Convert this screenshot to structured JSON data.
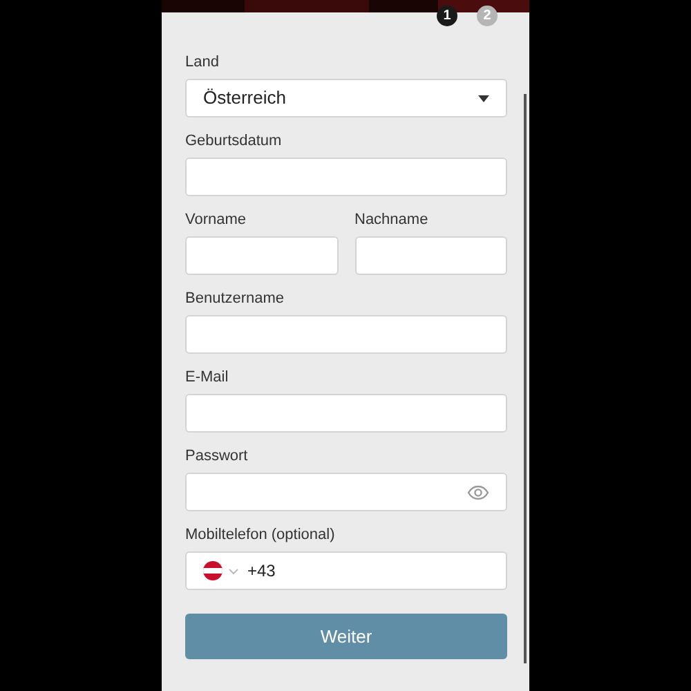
{
  "steps": [
    {
      "label": "1",
      "selected": true
    },
    {
      "label": "2",
      "selected": false
    }
  ],
  "fields": [
    {
      "kind": "select",
      "label": "Land",
      "value": "Österreich"
    },
    {
      "kind": "text",
      "label": "Geburtsdatum"
    },
    {
      "kind": "pair",
      "items": [
        {
          "label": "Vorname"
        },
        {
          "label": "Nachname"
        }
      ]
    },
    {
      "kind": "text",
      "label": "Benutzername"
    },
    {
      "kind": "text",
      "label": "E-Mail"
    },
    {
      "kind": "password",
      "label": "Passwort"
    },
    {
      "kind": "phone",
      "label": "Mobiltelefon (optional)",
      "value": "+43"
    }
  ],
  "button": "Weiter"
}
